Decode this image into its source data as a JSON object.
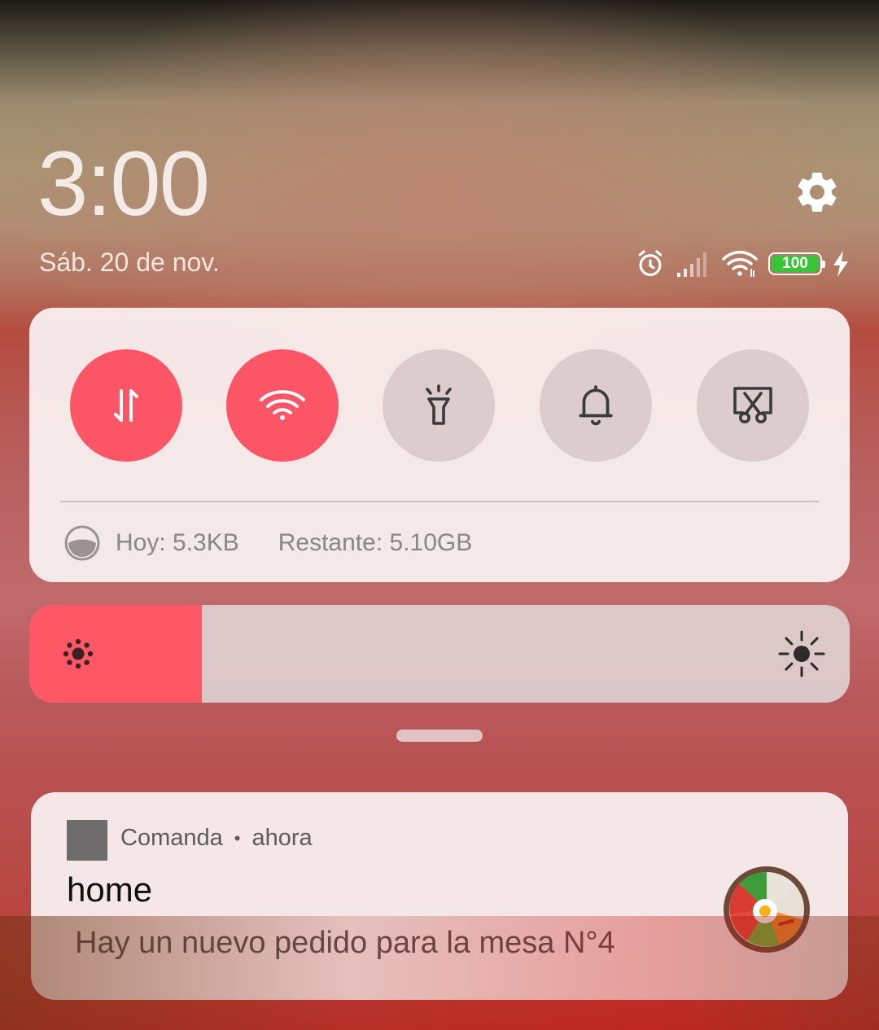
{
  "lockscreen": {
    "time": "3:00",
    "date": "Sáb. 20 de nov."
  },
  "status_bar": {
    "icons": [
      "alarm-icon",
      "signal-icon",
      "wifi-icon",
      "battery-icon",
      "charging-icon"
    ],
    "battery_level": "100",
    "battery_color": "#37c436"
  },
  "quick_settings": {
    "toggles": [
      {
        "name": "mobile-data-toggle",
        "icon": "arrows-up-down-icon",
        "active": true
      },
      {
        "name": "wifi-toggle",
        "icon": "wifi-icon",
        "active": true
      },
      {
        "name": "flashlight-toggle",
        "icon": "flashlight-icon",
        "active": false
      },
      {
        "name": "sound-toggle",
        "icon": "bell-icon",
        "active": false
      },
      {
        "name": "screenshot-toggle",
        "icon": "scissors-screen-icon",
        "active": false
      }
    ],
    "data_usage": {
      "today": "Hoy: 5.3KB",
      "remaining": "Restante: 5.10GB"
    },
    "accent_color": "#fc5565"
  },
  "brightness": {
    "level_fraction": 0.21,
    "low_icon": "brightness-low-icon",
    "high_icon": "brightness-high-icon"
  },
  "notification": {
    "app_name": "Comanda",
    "separator": "•",
    "time": "ahora",
    "title": "home",
    "body": "Hay un nuevo pedido para la mesa N°4",
    "image": "food-bowl-icon"
  }
}
